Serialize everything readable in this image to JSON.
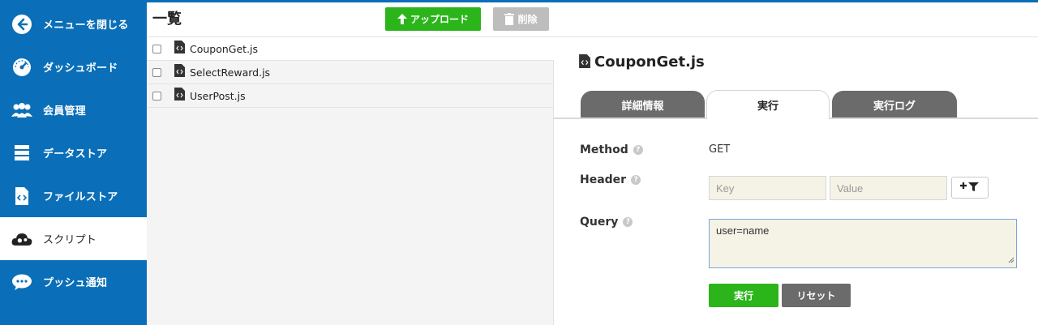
{
  "sidebar": {
    "items": [
      {
        "label": "メニューを閉じる",
        "icon": "back-arrow-icon"
      },
      {
        "label": "ダッシュボード",
        "icon": "gauge-icon"
      },
      {
        "label": "会員管理",
        "icon": "users-icon"
      },
      {
        "label": "データストア",
        "icon": "database-icon"
      },
      {
        "label": "ファイルストア",
        "icon": "code-file-icon"
      },
      {
        "label": "スクリプト",
        "icon": "cloud-gear-icon",
        "active": true
      },
      {
        "label": "プッシュ通知",
        "icon": "chat-bubble-icon"
      }
    ],
    "colors": {
      "background": "#0a6fb8",
      "active_background": "#ffffff"
    }
  },
  "list": {
    "title": "一覧",
    "upload_label": "アップロード",
    "delete_label": "削除",
    "files": [
      {
        "name": "CouponGet.js"
      },
      {
        "name": "SelectReward.js"
      },
      {
        "name": "UserPost.js"
      }
    ]
  },
  "detail": {
    "title": "CouponGet.js",
    "tabs": [
      {
        "label": "詳細情報",
        "active": false
      },
      {
        "label": "実行",
        "active": true
      },
      {
        "label": "実行ログ",
        "active": false
      }
    ],
    "fields": {
      "method_label": "Method",
      "method_value": "GET",
      "header_label": "Header",
      "header_key_placeholder": "Key",
      "header_value_placeholder": "Value",
      "query_label": "Query",
      "query_value": "user=name",
      "help_glyph": "?"
    },
    "run_label": "実行",
    "reset_label": "リセット"
  },
  "colors": {
    "accent_green": "#2bb51a",
    "gray_button": "#6b6b6b",
    "input_bg": "#f5f3e6"
  }
}
